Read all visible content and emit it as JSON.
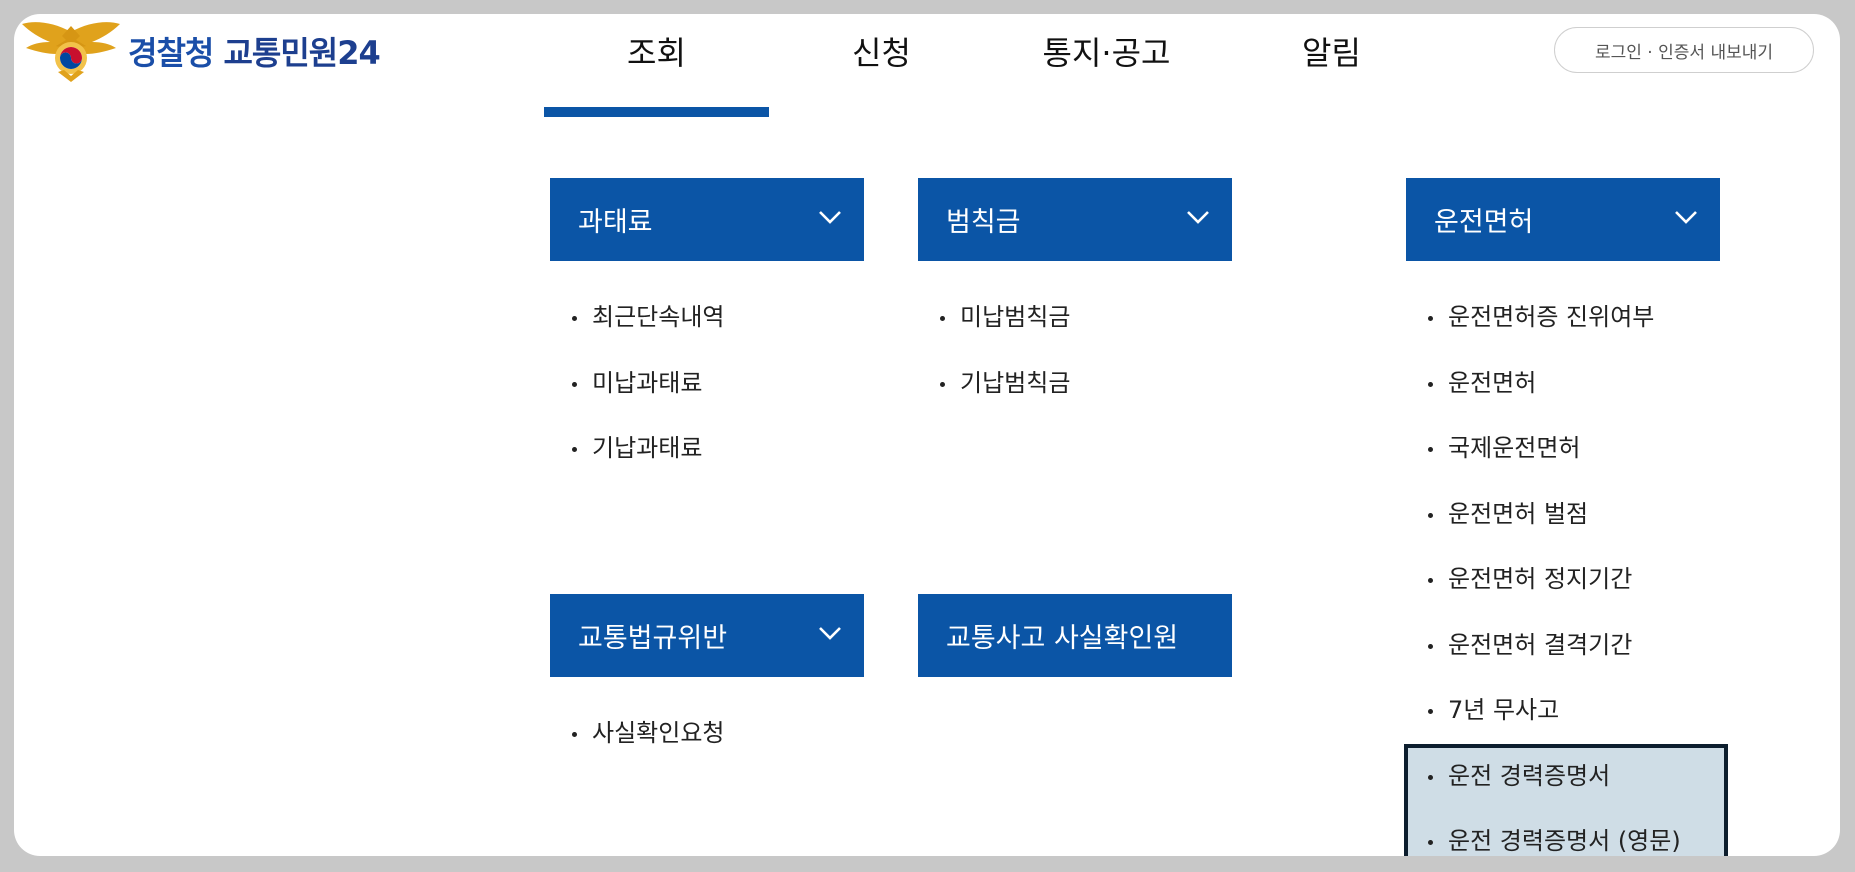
{
  "header": {
    "site_title_a": "경찰청",
    "site_title_b": "교통민원24",
    "emblem_icon": "police-emblem-icon",
    "login_label": "로그인 · 인증서 내보내기"
  },
  "nav": {
    "items": [
      {
        "label": "조회",
        "active": true
      },
      {
        "label": "신청"
      },
      {
        "label": "통지·공고"
      },
      {
        "label": "알림"
      }
    ]
  },
  "colors": {
    "primary": "#0b55a6",
    "highlight_bg": "#cfdde6",
    "highlight_border": "#0d1e2e"
  },
  "menu": {
    "fines": {
      "title": "과태료",
      "items": [
        "최근단속내역",
        "미납과태료",
        "기납과태료"
      ]
    },
    "penalties": {
      "title": "범칙금",
      "items": [
        "미납범칙금",
        "기납범칙금"
      ]
    },
    "license": {
      "title": "운전면허",
      "items": [
        "운전면허증 진위여부",
        "운전면허",
        "국제운전면허",
        "운전면허 벌점",
        "운전면허 정지기간",
        "운전면허 결격기간",
        "7년 무사고",
        "운전 경력증명서",
        "운전 경력증명서 (영문)"
      ]
    },
    "violation": {
      "title": "교통법규위반",
      "items": [
        "사실확인요청"
      ]
    },
    "accident": {
      "title": "교통사고 사실확인원"
    }
  }
}
